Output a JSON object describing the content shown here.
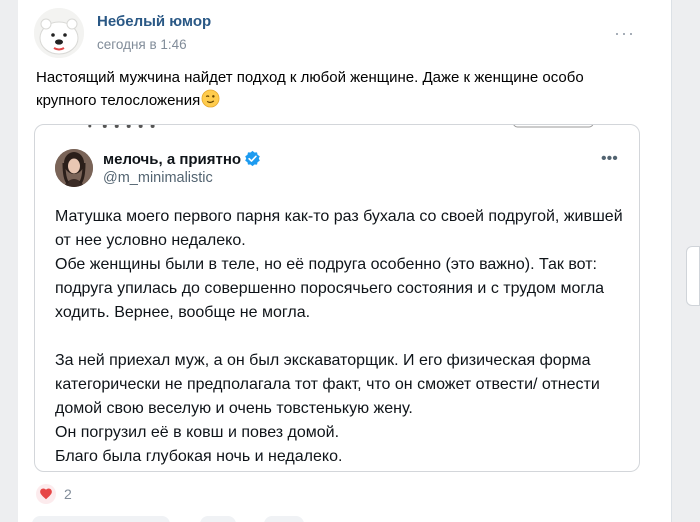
{
  "post": {
    "author": "Небелый юмор",
    "time": "сегодня в 1:46",
    "text": "Настоящий мужчина найдет подход к любой женщине. Даже к женщине особо крупного телосложения"
  },
  "quoted_tweet": {
    "name": "мелочь, а приятно",
    "handle": "@m_minimalistic",
    "paragraphs": [
      "Матушка моего первого парня как-то раз бухала со своей подругой, жившей от нее условно недалеко.",
      "Обе женщины были в теле, но её подруга особенно (это важно). Так вот: подруга упилась до совершенно поросячьего состояния и с трудом могла ходить. Вернее, вообще не могла.",
      "За ней приехал муж, а он был экскаваторщик. И его физическая форма категорически не предполагала тот факт, что он сможет отвести/ отнести домой свою веселую и очень товстенькую жену.",
      "Он погрузил её в ковш и повез домой.",
      "Благо была глубокая ночь и недалеко."
    ]
  },
  "reactions": {
    "likes": "2"
  },
  "icons": {
    "more": "more-horizontal-icon",
    "emoji": "winking-face-emoji",
    "verified": "verified-badge-icon",
    "like": "heart-icon"
  },
  "colors": {
    "author_link": "#2a5885",
    "meta": "#818c99",
    "verified": "#1d9bf0",
    "like": "#e64646"
  }
}
